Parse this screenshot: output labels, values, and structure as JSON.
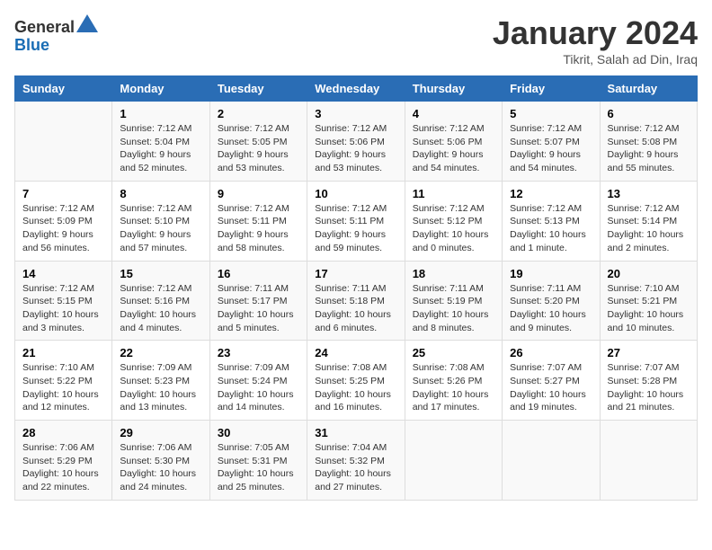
{
  "header": {
    "logo_general": "General",
    "logo_blue": "Blue",
    "month_title": "January 2024",
    "location": "Tikrit, Salah ad Din, Iraq"
  },
  "weekdays": [
    "Sunday",
    "Monday",
    "Tuesday",
    "Wednesday",
    "Thursday",
    "Friday",
    "Saturday"
  ],
  "weeks": [
    [
      {
        "day": "",
        "info": ""
      },
      {
        "day": "1",
        "info": "Sunrise: 7:12 AM\nSunset: 5:04 PM\nDaylight: 9 hours\nand 52 minutes."
      },
      {
        "day": "2",
        "info": "Sunrise: 7:12 AM\nSunset: 5:05 PM\nDaylight: 9 hours\nand 53 minutes."
      },
      {
        "day": "3",
        "info": "Sunrise: 7:12 AM\nSunset: 5:06 PM\nDaylight: 9 hours\nand 53 minutes."
      },
      {
        "day": "4",
        "info": "Sunrise: 7:12 AM\nSunset: 5:06 PM\nDaylight: 9 hours\nand 54 minutes."
      },
      {
        "day": "5",
        "info": "Sunrise: 7:12 AM\nSunset: 5:07 PM\nDaylight: 9 hours\nand 54 minutes."
      },
      {
        "day": "6",
        "info": "Sunrise: 7:12 AM\nSunset: 5:08 PM\nDaylight: 9 hours\nand 55 minutes."
      }
    ],
    [
      {
        "day": "7",
        "info": "Sunrise: 7:12 AM\nSunset: 5:09 PM\nDaylight: 9 hours\nand 56 minutes."
      },
      {
        "day": "8",
        "info": "Sunrise: 7:12 AM\nSunset: 5:10 PM\nDaylight: 9 hours\nand 57 minutes."
      },
      {
        "day": "9",
        "info": "Sunrise: 7:12 AM\nSunset: 5:11 PM\nDaylight: 9 hours\nand 58 minutes."
      },
      {
        "day": "10",
        "info": "Sunrise: 7:12 AM\nSunset: 5:11 PM\nDaylight: 9 hours\nand 59 minutes."
      },
      {
        "day": "11",
        "info": "Sunrise: 7:12 AM\nSunset: 5:12 PM\nDaylight: 10 hours\nand 0 minutes."
      },
      {
        "day": "12",
        "info": "Sunrise: 7:12 AM\nSunset: 5:13 PM\nDaylight: 10 hours\nand 1 minute."
      },
      {
        "day": "13",
        "info": "Sunrise: 7:12 AM\nSunset: 5:14 PM\nDaylight: 10 hours\nand 2 minutes."
      }
    ],
    [
      {
        "day": "14",
        "info": "Sunrise: 7:12 AM\nSunset: 5:15 PM\nDaylight: 10 hours\nand 3 minutes."
      },
      {
        "day": "15",
        "info": "Sunrise: 7:12 AM\nSunset: 5:16 PM\nDaylight: 10 hours\nand 4 minutes."
      },
      {
        "day": "16",
        "info": "Sunrise: 7:11 AM\nSunset: 5:17 PM\nDaylight: 10 hours\nand 5 minutes."
      },
      {
        "day": "17",
        "info": "Sunrise: 7:11 AM\nSunset: 5:18 PM\nDaylight: 10 hours\nand 6 minutes."
      },
      {
        "day": "18",
        "info": "Sunrise: 7:11 AM\nSunset: 5:19 PM\nDaylight: 10 hours\nand 8 minutes."
      },
      {
        "day": "19",
        "info": "Sunrise: 7:11 AM\nSunset: 5:20 PM\nDaylight: 10 hours\nand 9 minutes."
      },
      {
        "day": "20",
        "info": "Sunrise: 7:10 AM\nSunset: 5:21 PM\nDaylight: 10 hours\nand 10 minutes."
      }
    ],
    [
      {
        "day": "21",
        "info": "Sunrise: 7:10 AM\nSunset: 5:22 PM\nDaylight: 10 hours\nand 12 minutes."
      },
      {
        "day": "22",
        "info": "Sunrise: 7:09 AM\nSunset: 5:23 PM\nDaylight: 10 hours\nand 13 minutes."
      },
      {
        "day": "23",
        "info": "Sunrise: 7:09 AM\nSunset: 5:24 PM\nDaylight: 10 hours\nand 14 minutes."
      },
      {
        "day": "24",
        "info": "Sunrise: 7:08 AM\nSunset: 5:25 PM\nDaylight: 10 hours\nand 16 minutes."
      },
      {
        "day": "25",
        "info": "Sunrise: 7:08 AM\nSunset: 5:26 PM\nDaylight: 10 hours\nand 17 minutes."
      },
      {
        "day": "26",
        "info": "Sunrise: 7:07 AM\nSunset: 5:27 PM\nDaylight: 10 hours\nand 19 minutes."
      },
      {
        "day": "27",
        "info": "Sunrise: 7:07 AM\nSunset: 5:28 PM\nDaylight: 10 hours\nand 21 minutes."
      }
    ],
    [
      {
        "day": "28",
        "info": "Sunrise: 7:06 AM\nSunset: 5:29 PM\nDaylight: 10 hours\nand 22 minutes."
      },
      {
        "day": "29",
        "info": "Sunrise: 7:06 AM\nSunset: 5:30 PM\nDaylight: 10 hours\nand 24 minutes."
      },
      {
        "day": "30",
        "info": "Sunrise: 7:05 AM\nSunset: 5:31 PM\nDaylight: 10 hours\nand 25 minutes."
      },
      {
        "day": "31",
        "info": "Sunrise: 7:04 AM\nSunset: 5:32 PM\nDaylight: 10 hours\nand 27 minutes."
      },
      {
        "day": "",
        "info": ""
      },
      {
        "day": "",
        "info": ""
      },
      {
        "day": "",
        "info": ""
      }
    ]
  ]
}
